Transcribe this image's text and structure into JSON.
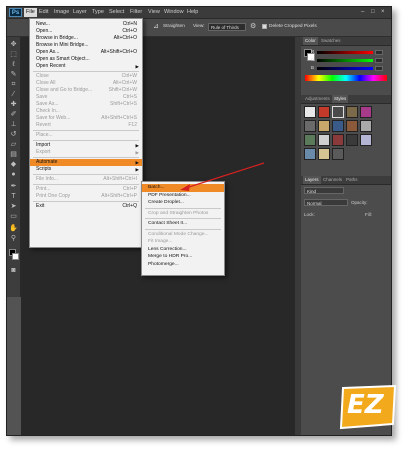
{
  "app": {
    "logo_text": "Ps"
  },
  "menubar": {
    "items": [
      "File",
      "Edit",
      "Image",
      "Layer",
      "Type",
      "Select",
      "Filter",
      "View",
      "Window",
      "Help"
    ],
    "window_controls": [
      "–",
      "□",
      "×"
    ]
  },
  "options_bar": {
    "straighten": "Straighten",
    "view_label": "View:",
    "view_value": "Rule of Thirds",
    "delete_cropped": "Delete Cropped Pixels"
  },
  "file_menu": [
    {
      "label": "New...",
      "shortcut": "Ctrl+N",
      "enabled": true
    },
    {
      "label": "Open...",
      "shortcut": "Ctrl+O",
      "enabled": true
    },
    {
      "label": "Browse in Bridge...",
      "shortcut": "Alt+Ctrl+O",
      "enabled": true
    },
    {
      "label": "Browse in Mini Bridge...",
      "shortcut": "",
      "enabled": true
    },
    {
      "label": "Open As...",
      "shortcut": "Alt+Shift+Ctrl+O",
      "enabled": true
    },
    {
      "label": "Open as Smart Object...",
      "shortcut": "",
      "enabled": true
    },
    {
      "label": "Open Recent",
      "shortcut": "",
      "enabled": true,
      "submenu": true
    },
    {
      "sep": true
    },
    {
      "label": "Close",
      "shortcut": "Ctrl+W",
      "enabled": false
    },
    {
      "label": "Close All",
      "shortcut": "Alt+Ctrl+W",
      "enabled": false
    },
    {
      "label": "Close and Go to Bridge...",
      "shortcut": "Shift+Ctrl+W",
      "enabled": false
    },
    {
      "label": "Save",
      "shortcut": "Ctrl+S",
      "enabled": false
    },
    {
      "label": "Save As...",
      "shortcut": "Shift+Ctrl+S",
      "enabled": false
    },
    {
      "label": "Check In...",
      "shortcut": "",
      "enabled": false
    },
    {
      "label": "Save for Web...",
      "shortcut": "Alt+Shift+Ctrl+S",
      "enabled": false
    },
    {
      "label": "Revert",
      "shortcut": "F12",
      "enabled": false
    },
    {
      "sep": true
    },
    {
      "label": "Place...",
      "shortcut": "",
      "enabled": false
    },
    {
      "sep": true
    },
    {
      "label": "Import",
      "shortcut": "",
      "enabled": true,
      "submenu": true
    },
    {
      "label": "Export",
      "shortcut": "",
      "enabled": false,
      "submenu": true
    },
    {
      "sep": true
    },
    {
      "label": "Automate",
      "shortcut": "",
      "enabled": true,
      "submenu": true,
      "highlighted": true
    },
    {
      "label": "Scripts",
      "shortcut": "",
      "enabled": true,
      "submenu": true
    },
    {
      "sep": true
    },
    {
      "label": "File Info...",
      "shortcut": "Alt+Shift+Ctrl+I",
      "enabled": false
    },
    {
      "sep": true
    },
    {
      "label": "Print...",
      "shortcut": "Ctrl+P",
      "enabled": false
    },
    {
      "label": "Print One Copy",
      "shortcut": "Alt+Shift+Ctrl+P",
      "enabled": false
    },
    {
      "sep": true
    },
    {
      "label": "Exit",
      "shortcut": "Ctrl+Q",
      "enabled": true
    }
  ],
  "automate_submenu": [
    {
      "label": "Batch...",
      "enabled": true,
      "highlighted": true
    },
    {
      "label": "PDF Presentation...",
      "enabled": true
    },
    {
      "label": "Create Droplet...",
      "enabled": true
    },
    {
      "sep": true
    },
    {
      "label": "Crop and Straighten Photos",
      "enabled": false
    },
    {
      "sep": true
    },
    {
      "label": "Contact Sheet II...",
      "enabled": true
    },
    {
      "sep": true
    },
    {
      "label": "Conditional Mode Change...",
      "enabled": false
    },
    {
      "label": "Fit Image...",
      "enabled": false
    },
    {
      "label": "Lens Correction...",
      "enabled": true
    },
    {
      "label": "Merge to HDR Pro...",
      "enabled": true
    },
    {
      "label": "Photomerge...",
      "enabled": true
    }
  ],
  "color_panel": {
    "tabs": [
      "Color",
      "Swatches"
    ],
    "channels": [
      "R",
      "G",
      "B"
    ]
  },
  "adjustments_panel": {
    "tabs": [
      "Adjustments",
      "Styles"
    ]
  },
  "layers_panel": {
    "tabs": [
      "Layers",
      "Channels",
      "Paths"
    ],
    "kind_label": "Kind",
    "blend_mode": "Normal",
    "opacity_label": "Opacity:",
    "lock_label": "Lock:",
    "fill_label": "Fill:"
  },
  "watermark": {
    "text": "EZ"
  },
  "colors": {
    "accent": "#ef8a26",
    "arrow": "#d62020",
    "logo_bg": "#f2a91c"
  }
}
